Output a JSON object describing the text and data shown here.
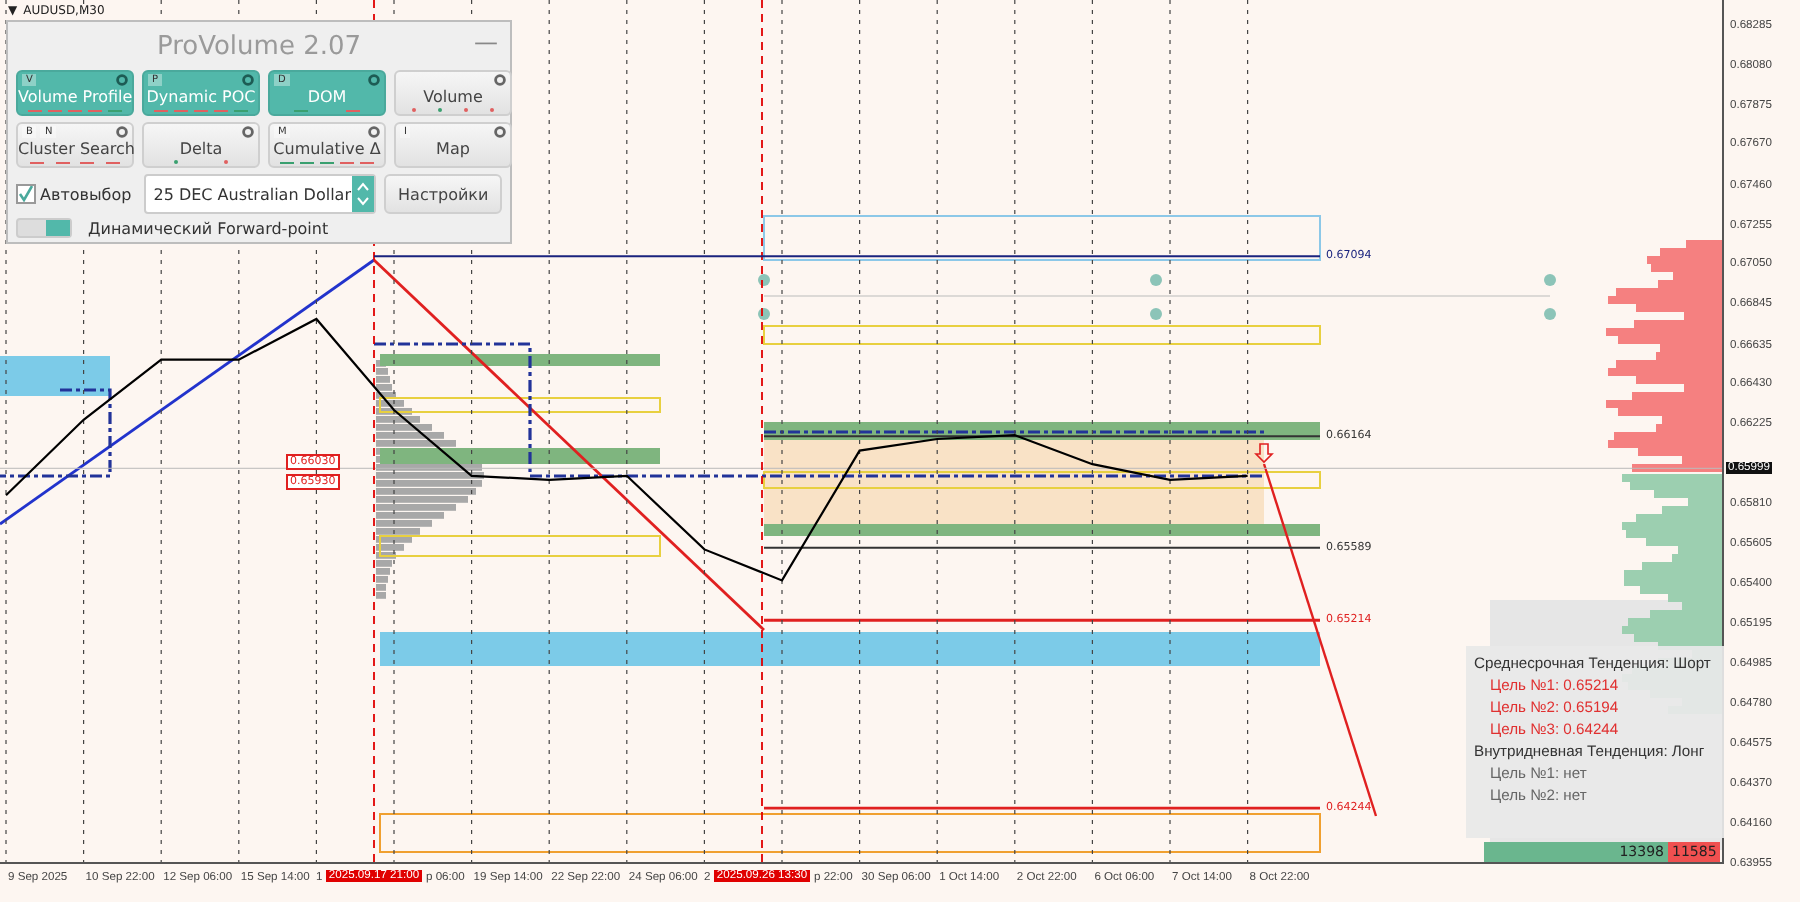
{
  "symbol": {
    "menu_glyph": "▼",
    "label": "AUDUSD,M30"
  },
  "panel": {
    "title": "ProVolume 2.07",
    "minimize": "—",
    "buttons": [
      {
        "label": "Volume Profile",
        "keys": [
          "V"
        ],
        "active": true,
        "indicators": [
          {
            "kind": "dash",
            "color": "#e06060"
          },
          {
            "kind": "dash",
            "color": "#e06060"
          },
          {
            "kind": "dash",
            "color": "#e06060"
          },
          {
            "kind": "dash",
            "color": "#e06060"
          },
          {
            "kind": "dash",
            "color": "#3aa070"
          }
        ]
      },
      {
        "label": "Dynamic POC",
        "keys": [
          "P"
        ],
        "active": true,
        "indicators": [
          {
            "kind": "dash",
            "color": "#e06060"
          },
          {
            "kind": "dash",
            "color": "#e06060"
          },
          {
            "kind": "dash",
            "color": "#e06060"
          },
          {
            "kind": "dash",
            "color": "#e06060"
          },
          {
            "kind": "dash",
            "color": "#3aa070"
          }
        ]
      },
      {
        "label": "DOM",
        "keys": [
          "D"
        ],
        "active": true,
        "indicators": [
          {
            "kind": "dash",
            "color": "#3aa070"
          },
          {
            "kind": "dash",
            "color": "#e06060"
          }
        ]
      },
      {
        "label": "Volume",
        "active": false,
        "indicators": [
          {
            "kind": "dot",
            "color": "#e06060"
          },
          {
            "kind": "dot",
            "color": "#3aa070"
          },
          {
            "kind": "dot",
            "color": "#e06060"
          },
          {
            "kind": "dot",
            "color": "#e06060"
          }
        ]
      },
      {
        "label": "Cluster Search",
        "keys": [
          "B",
          "N"
        ],
        "active": false,
        "indicators": [
          {
            "kind": "dash",
            "color": "#e06060"
          },
          {
            "kind": "dash",
            "color": "#e06060"
          },
          {
            "kind": "dash",
            "color": "#e06060"
          },
          {
            "kind": "dash",
            "color": "#e06060"
          }
        ]
      },
      {
        "label": "Delta",
        "active": false,
        "indicators": [
          {
            "kind": "dot",
            "color": "#3aa070"
          },
          {
            "kind": "dot",
            "color": "#e06060"
          }
        ]
      },
      {
        "label": "Cumulative Δ",
        "keys": [
          "M"
        ],
        "active": false,
        "indicators": [
          {
            "kind": "dash",
            "color": "#3aa070"
          },
          {
            "kind": "dash",
            "color": "#3aa070"
          },
          {
            "kind": "dash",
            "color": "#3aa070"
          },
          {
            "kind": "dash",
            "color": "#e06060"
          },
          {
            "kind": "dash",
            "color": "#e06060"
          }
        ]
      },
      {
        "label": "Map",
        "keys": [
          "I"
        ],
        "active": false
      }
    ],
    "auto_select": {
      "label": "Автовыбор",
      "checked": true
    },
    "instrument": {
      "value": "25 DEC Australian Dollar"
    },
    "settings_button": "Настройки",
    "forward_point": {
      "label": "Динамический Forward-point",
      "on": true
    }
  },
  "chart": {
    "chart_data": {
      "type": "line",
      "grid": true,
      "categories": [
        "9 Sep 2025",
        "10 Sep 22:00",
        "12 Sep 06:00",
        "15 Sep 14:00",
        null,
        null,
        "19 Sep 14:00",
        "22 Sep 22:00",
        "24 Sep 06:00",
        null,
        null,
        "30 Sep 06:00",
        "1 Oct 14:00",
        "2 Oct 22:00",
        "6 Oct 06:00",
        "7 Oct 14:00",
        "8 Oct 22:00"
      ],
      "series": [
        {
          "color": "#000000",
          "values": [
            0.6586,
            0.6625,
            0.6656,
            0.6656,
            0.6677,
            0.663,
            0.6596,
            0.6594,
            0.6596,
            0.6558,
            0.6542,
            0.6609,
            0.6615,
            0.6617,
            0.6602,
            0.6594,
            0.6596
          ]
        }
      ],
      "ylim": [
        0.63955,
        0.68418
      ],
      "yticks": [
        {
          "value": 0.68285,
          "label": "0.68285"
        },
        {
          "value": 0.6808,
          "label": "0.68080"
        },
        {
          "value": 0.67875,
          "label": "0.67875"
        },
        {
          "value": 0.6767,
          "label": "0.67670"
        },
        {
          "value": 0.6746,
          "label": "0.67460"
        },
        {
          "value": 0.67255,
          "label": "0.67255"
        },
        {
          "value": 0.6705,
          "label": "0.67050"
        },
        {
          "value": 0.66845,
          "label": "0.66845"
        },
        {
          "value": 0.66635,
          "label": "0.66635"
        },
        {
          "value": 0.6643,
          "label": "0.66430"
        },
        {
          "value": 0.66225,
          "label": "0.66225"
        },
        {
          "value": 0.6581,
          "label": "0.65810"
        },
        {
          "value": 0.65605,
          "label": "0.65605"
        },
        {
          "value": 0.654,
          "label": "0.65400"
        },
        {
          "value": 0.65195,
          "label": "0.65195"
        },
        {
          "value": 0.64985,
          "label": "0.64985"
        },
        {
          "value": 0.6478,
          "label": "0.64780"
        },
        {
          "value": 0.64575,
          "label": "0.64575"
        },
        {
          "value": 0.6437,
          "label": "0.64370"
        },
        {
          "value": 0.6416,
          "label": "0.64160"
        },
        {
          "value": 0.63955,
          "label": "0.63955"
        }
      ]
    },
    "axis_label_fragments": [
      "1",
      "p 06:00",
      "2",
      "p 22:00"
    ],
    "time_markers": [
      {
        "label": "2025.09.17 21:00",
        "color": "#e00000"
      },
      {
        "label": "2025.09.26 13:30",
        "color": "#e00000"
      }
    ],
    "current_price": "0.65999",
    "levels": [
      {
        "label": "0.67094",
        "color": "#1a237e"
      },
      {
        "label": "0.66164",
        "color": "#333333"
      },
      {
        "label": "0.65589",
        "color": "#333333"
      },
      {
        "label": "0.65214",
        "color": "#e02020"
      },
      {
        "label": "0.64244",
        "color": "#e02020"
      }
    ],
    "price_tags": [
      {
        "label": "0.66030",
        "color": "#e02020"
      },
      {
        "label": "0.65930",
        "color": "#e02020"
      }
    ]
  },
  "trend_info": {
    "medium_term": "Среднесрочная Тенденция: Шорт",
    "medium_targets": [
      "Цель №1: 0.65214",
      "Цель №2: 0.65194",
      "Цель №3: 0.64244"
    ],
    "intraday": "Внутридневная Тенденция: Лонг",
    "intraday_targets": [
      "Цель №1: нет",
      "Цель №2: нет"
    ]
  },
  "volume_balance": {
    "buy": "13398",
    "sell": "11585"
  }
}
